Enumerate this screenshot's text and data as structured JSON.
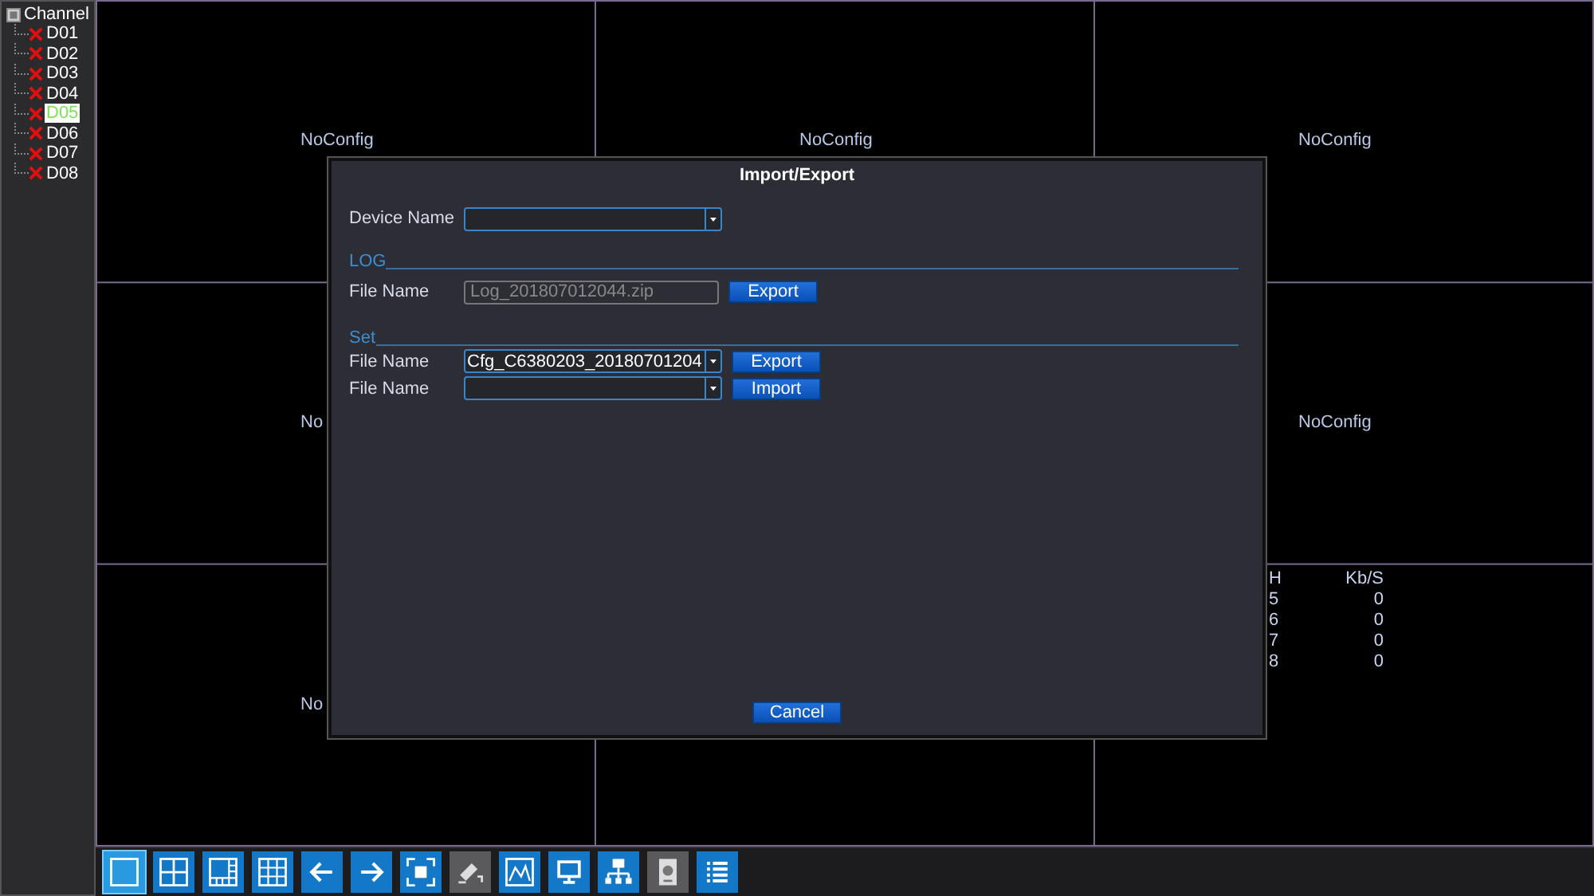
{
  "sidebar": {
    "title": "Channel",
    "items": [
      {
        "label": "D01",
        "selected": false
      },
      {
        "label": "D02",
        "selected": false
      },
      {
        "label": "D03",
        "selected": false
      },
      {
        "label": "D04",
        "selected": false
      },
      {
        "label": "D05",
        "selected": true
      },
      {
        "label": "D06",
        "selected": false
      },
      {
        "label": "D07",
        "selected": false
      },
      {
        "label": "D08",
        "selected": false
      }
    ]
  },
  "cells": [
    {
      "label": "NoConfig"
    },
    {
      "label": "NoConfig"
    },
    {
      "label": "NoConfig"
    },
    {
      "label": "No"
    },
    {},
    {
      "label": "NoConfig"
    },
    {
      "label": "No"
    },
    {},
    {
      "stats": {
        "columns": [
          "H",
          "Kb/S"
        ],
        "rows": [
          [
            "5",
            "0"
          ],
          [
            "6",
            "0"
          ],
          [
            "7",
            "0"
          ],
          [
            "8",
            "0"
          ]
        ]
      }
    }
  ],
  "dialog": {
    "title": "Import/Export",
    "device_name": {
      "label": "Device Name"
    },
    "log": {
      "heading": "LOG",
      "label": "File Name",
      "value": "Log_201807012044.zip",
      "button": "Export"
    },
    "set": {
      "heading": "Set",
      "rows": [
        {
          "label": "File Name",
          "value": "Cfg_C6380203_20180701204",
          "button": "Export"
        },
        {
          "label": "File Name",
          "button": "Import"
        }
      ]
    },
    "cancel": "Cancel"
  },
  "toolbar": [
    {
      "kind": "single",
      "selected": true,
      "disabled": false
    },
    {
      "kind": "quad",
      "selected": false,
      "disabled": false
    },
    {
      "kind": "six",
      "selected": false,
      "disabled": false
    },
    {
      "kind": "nine",
      "selected": false,
      "disabled": false
    },
    {
      "kind": "left",
      "selected": false,
      "disabled": false
    },
    {
      "kind": "right",
      "selected": false,
      "disabled": false
    },
    {
      "kind": "fullscreen",
      "selected": false,
      "disabled": false
    },
    {
      "kind": "camera",
      "selected": false,
      "disabled": true
    },
    {
      "kind": "chart",
      "selected": false,
      "disabled": false
    },
    {
      "kind": "monitor",
      "selected": false,
      "disabled": false
    },
    {
      "kind": "network",
      "selected": false,
      "disabled": false
    },
    {
      "kind": "disk",
      "selected": false,
      "disabled": true
    },
    {
      "kind": "list",
      "selected": false,
      "disabled": false
    }
  ]
}
